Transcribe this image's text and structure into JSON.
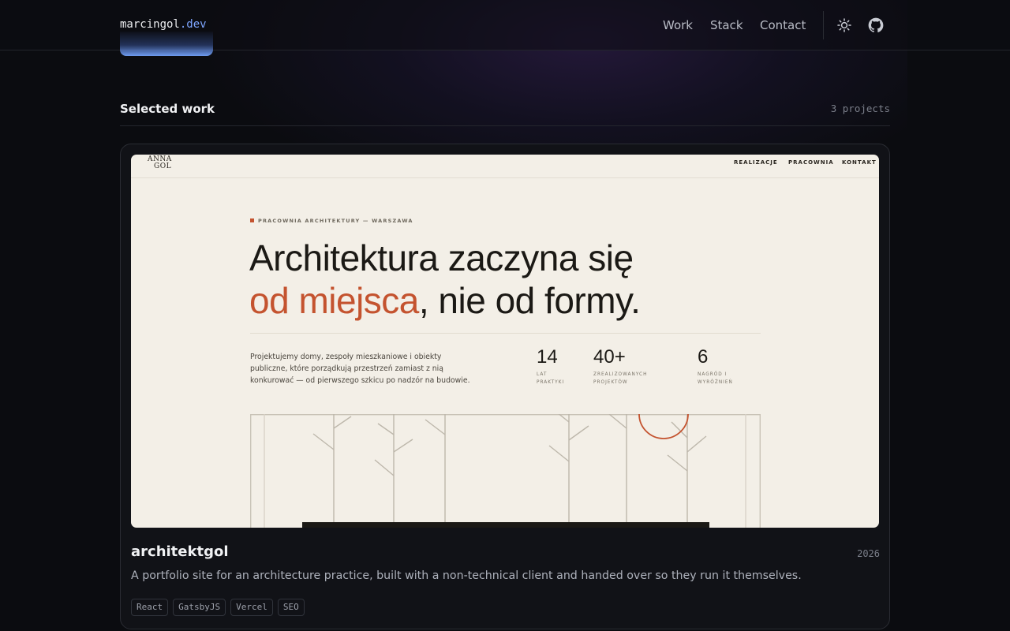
{
  "header": {
    "brand_name": "marcingol",
    "brand_tld": ".dev",
    "nav": [
      "Work",
      "Stack",
      "Contact"
    ],
    "icons": [
      "sun-icon",
      "github-icon"
    ]
  },
  "section": {
    "title": "Selected work",
    "count": "3 projects"
  },
  "project": {
    "title": "architektgol",
    "year": "2026",
    "description": "A portfolio site for an architecture practice, built with a non-technical client and handed over so they run it themselves.",
    "tags": [
      "React",
      "GatsbyJS",
      "Vercel",
      "SEO"
    ],
    "preview": {
      "logo_line1": "ANNA",
      "logo_line2": "GOL",
      "nav": [
        "REALIZACJE",
        "PRACOWNIA",
        "KONTAKT"
      ],
      "eyebrow": "PRACOWNIA ARCHITEKTURY — WARSZAWA",
      "headline_line1": "Architektura zaczyna się",
      "headline_accent": "od miejsca",
      "headline_rest": ", nie od formy.",
      "description": "Projektujemy domy, zespoły mieszkaniowe i obiekty publiczne, które porządkują przestrzeń zamiast z nią konkurować — od pierwszego szkicu po nadzór na budowie.",
      "stats": [
        {
          "value": "14",
          "label": "LAT PRAKTYKI"
        },
        {
          "value": "40+",
          "label": "ZREALIZOWANYCH PROJEKTÓW"
        },
        {
          "value": "6",
          "label": "NAGRÓD I WYRÓŻNIEŃ"
        }
      ],
      "accent_color": "#c4532f"
    }
  },
  "colors": {
    "background": "#0b0c10",
    "link_accent": "#7ea6ff",
    "preview_bg": "#f3efe7"
  }
}
